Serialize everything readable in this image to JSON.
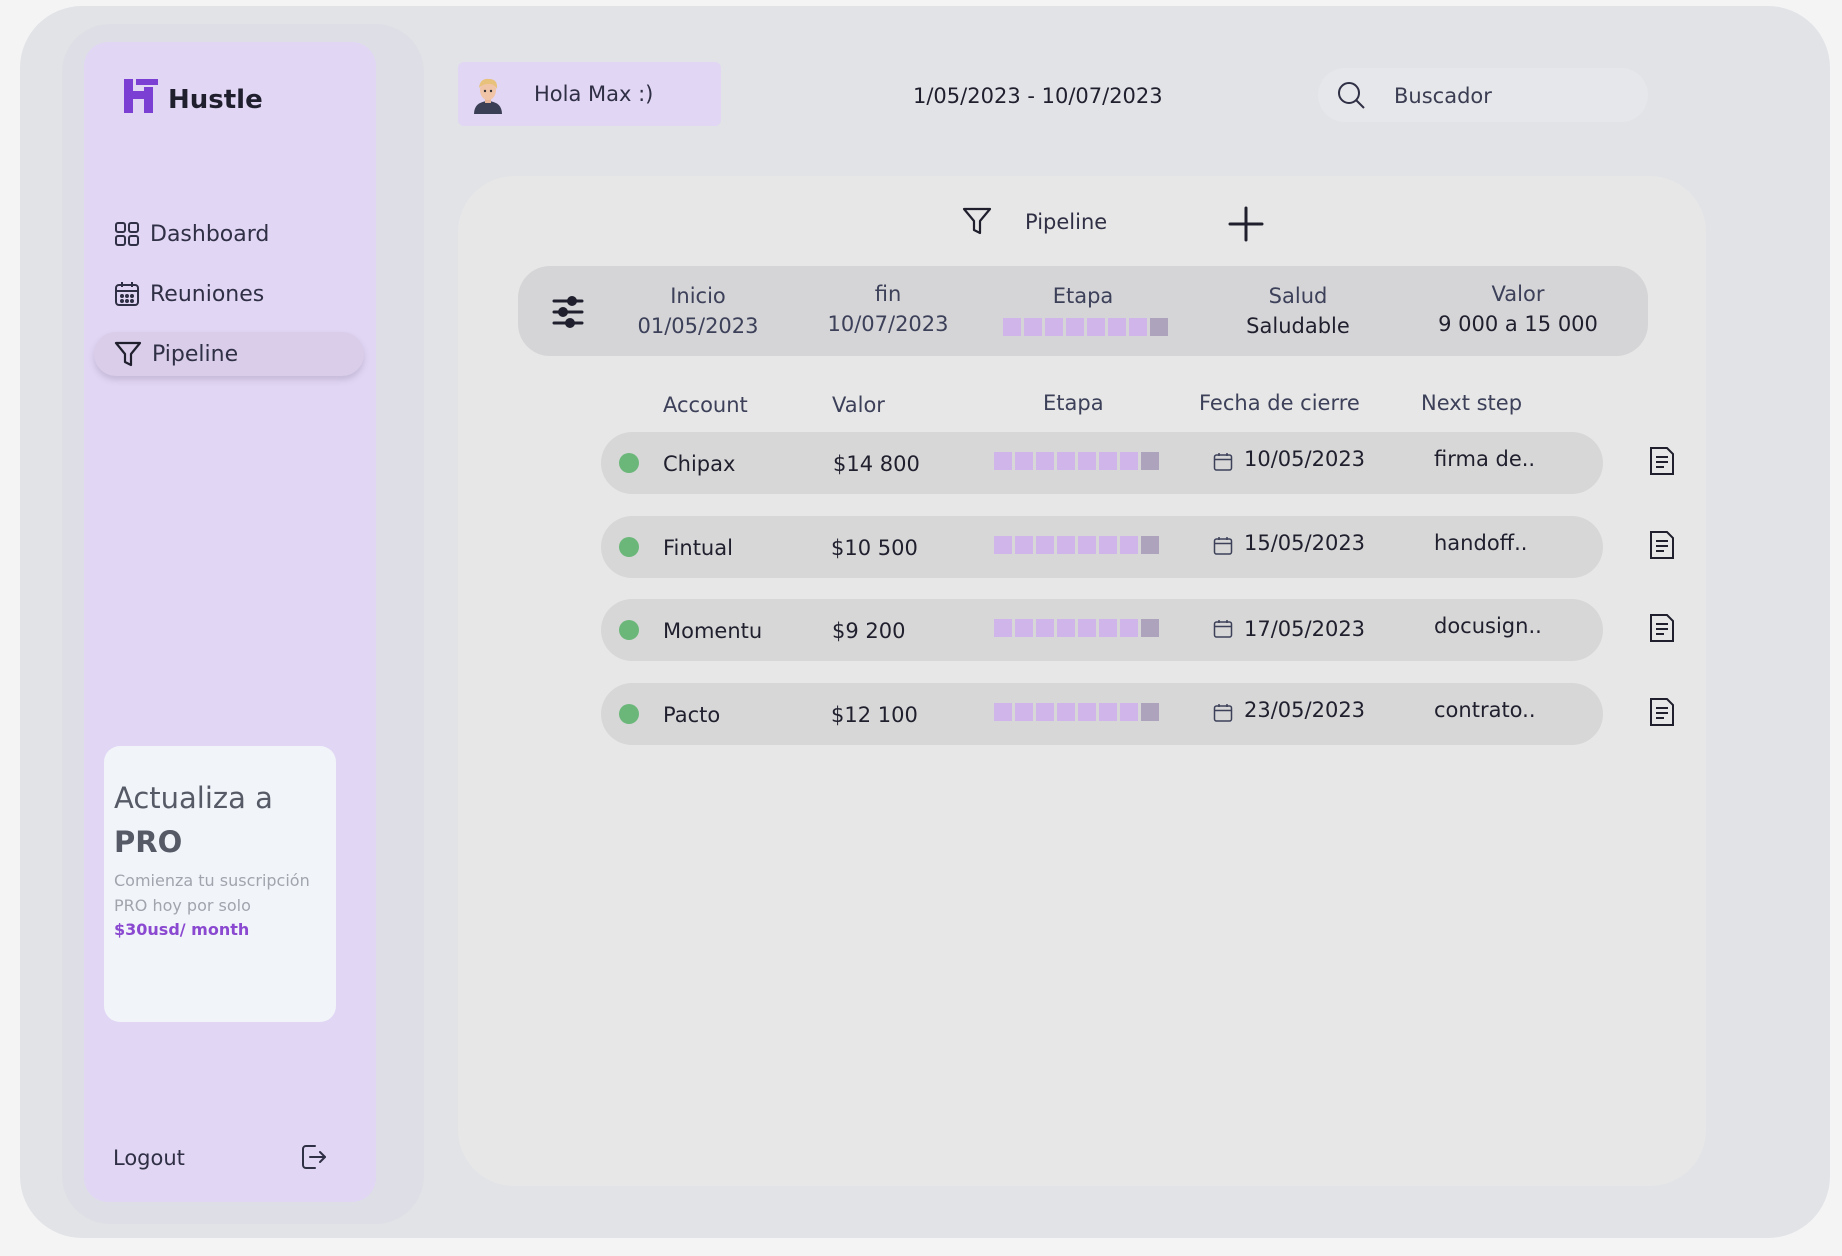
{
  "app": {
    "name": "Hustle"
  },
  "sidebar": {
    "items": [
      {
        "label": "Dashboard",
        "icon": "grid-icon"
      },
      {
        "label": "Reuniones",
        "icon": "calendar-icon"
      },
      {
        "label": "Pipeline",
        "icon": "funnel-icon",
        "active": true
      }
    ],
    "promo": {
      "title_line1": "Actualiza a",
      "title_line2": "PRO",
      "description": "Comienza tu suscripción PRO hoy por solo",
      "price": "$30usd/ month"
    },
    "logout_label": "Logout"
  },
  "header": {
    "greeting": "Hola Max :)",
    "date_range": "1/05/2023 - 10/07/2023",
    "search_placeholder": "Buscador"
  },
  "pipeline": {
    "title": "Pipeline",
    "filters": {
      "inicio_label": "Inicio",
      "inicio_value": "01/05/2023",
      "fin_label": "fin",
      "fin_value": "10/07/2023",
      "etapa_label": "Etapa",
      "salud_label": "Salud",
      "salud_value": "Saludable",
      "valor_label": "Valor",
      "valor_value": "9 000 a 15 000"
    },
    "columns": {
      "account": "Account",
      "valor": "Valor",
      "etapa": "Etapa",
      "fecha": "Fecha de cierre",
      "next": "Next step"
    },
    "rows": [
      {
        "account": "Chipax",
        "valor": "$14 800",
        "fecha": "10/05/2023",
        "next": "firma de..",
        "stage_progress": "7/8",
        "status": "green"
      },
      {
        "account": "Fintual",
        "valor": "$10 500",
        "fecha": "15/05/2023",
        "next": "handoff..",
        "stage_progress": "7/8",
        "status": "green"
      },
      {
        "account": "Momentu",
        "valor": "$9 200",
        "fecha": "17/05/2023",
        "next": "docusign..",
        "stage_progress": "7/8",
        "status": "green"
      },
      {
        "account": "Pacto",
        "valor": "$12 100",
        "fecha": "23/05/2023",
        "next": "contrato..",
        "stage_progress": "7/8",
        "status": "green"
      }
    ]
  },
  "colors": {
    "sidebar_bg": "#e1d6f4",
    "accent": "#8a49d0",
    "stage_fill": "#cfb5ea",
    "stage_last": "#ada3bc",
    "status_green": "#6bb77a"
  }
}
